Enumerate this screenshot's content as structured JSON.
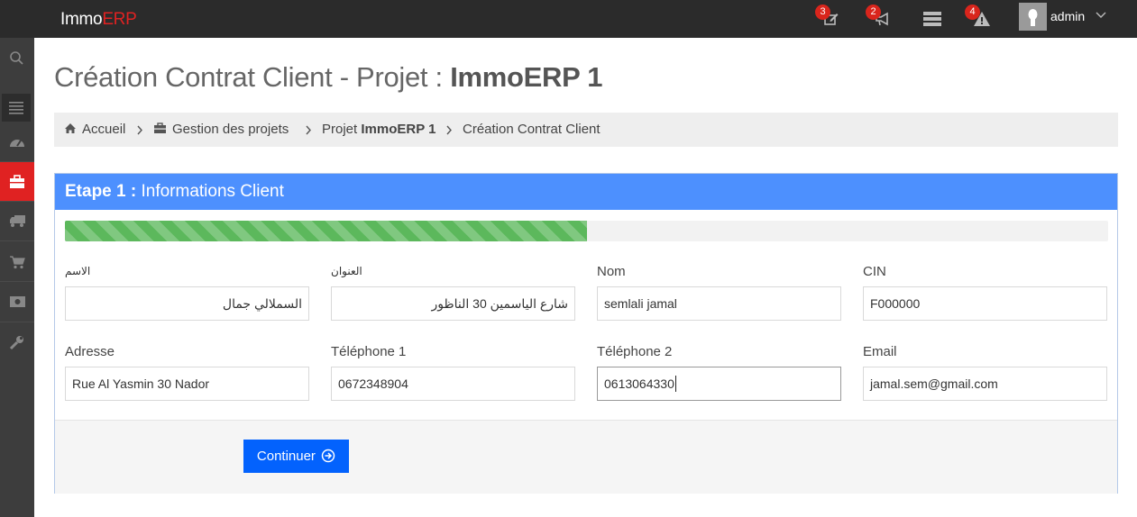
{
  "app": {
    "logo_main": "Immo",
    "logo_accent": "ERP"
  },
  "topbar": {
    "badges": [
      {
        "icon": "edit-icon",
        "count": "3"
      },
      {
        "icon": "bullhorn-icon",
        "count": "2"
      },
      {
        "icon": "server-icon",
        "count": ""
      },
      {
        "icon": "warning-icon",
        "count": "4"
      }
    ],
    "user": "admin"
  },
  "sidebar": {
    "items": [
      "search-icon",
      "menu-icon",
      "dashboard-icon",
      "briefcase-icon",
      "truck-icon",
      "cart-icon",
      "money-icon",
      "wrench-icon"
    ],
    "active": "briefcase-icon"
  },
  "page": {
    "title_prefix": "Création Contrat Client - Projet : ",
    "title_project": "ImmoERP 1"
  },
  "breadcrumb": {
    "home": "Accueil",
    "projects": "Gestion des projets",
    "project_prefix": "Projet ",
    "project_name": "ImmoERP 1",
    "current": "Création Contrat Client"
  },
  "panel": {
    "step_label": "Etape 1 :",
    "step_title": " Informations Client",
    "progress_percent": 50
  },
  "form": {
    "name_ar_label": "الاسم",
    "name_ar_value": "السملالي جمال",
    "address_ar_label": "العنوان",
    "address_ar_value": "شارع الياسمين 30 الناظور",
    "nom_label": "Nom",
    "nom_value": "semlali jamal",
    "cin_label": "CIN",
    "cin_value": "F000000",
    "adresse_label": "Adresse",
    "adresse_value": "Rue Al Yasmin 30 Nador",
    "tel1_label": "Téléphone 1",
    "tel1_value": "0672348904",
    "tel2_label": "Téléphone 2",
    "tel2_value": "0613064330",
    "email_label": "Email",
    "email_value": "jamal.sem@gmail.com"
  },
  "actions": {
    "continue_label": "Continuer"
  },
  "colors": {
    "accent_red": "#e02222",
    "panel_blue": "#4d90fe",
    "button_blue": "#0362fd",
    "progress_green": "#5cb85c"
  }
}
